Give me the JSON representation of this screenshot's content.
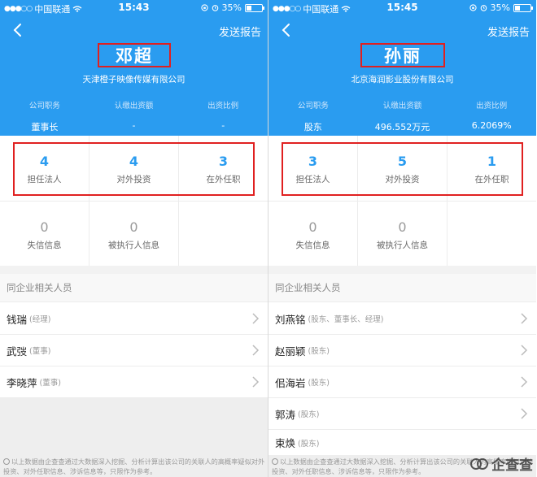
{
  "status_bar": {
    "left": {
      "carrier": "中国联通",
      "time": "15:43",
      "battery": "35%",
      "battery_level": 0.35
    },
    "right": {
      "carrier": "中国联通",
      "time": "15:45",
      "battery": "35%",
      "battery_level": 0.35
    }
  },
  "colors": {
    "header_blue": "#2a9cf0",
    "highlight_red": "#e02020",
    "stat_blue": "#2a9cf0"
  },
  "icons": {
    "back": "chevron-left-icon",
    "row": "chevron-right-icon",
    "wifi": "wifi-icon",
    "alarm": "alarm-icon",
    "lock": "lock-rotation-icon",
    "battery": "battery-icon"
  },
  "left": {
    "report_label": "发送报告",
    "name": "邓超",
    "company": "天津橙子映像传媒有限公司",
    "meta": [
      {
        "label": "公司职务",
        "value": "董事长"
      },
      {
        "label": "认缴出资额",
        "value": "-"
      },
      {
        "label": "出资比例",
        "value": "-"
      }
    ],
    "stats": [
      {
        "value": "4",
        "label": "担任法人"
      },
      {
        "value": "4",
        "label": "对外投资"
      },
      {
        "value": "3",
        "label": "在外任职"
      }
    ],
    "stats2": [
      {
        "value": "0",
        "label": "失信信息"
      },
      {
        "value": "0",
        "label": "被执行人信息"
      }
    ],
    "section_title": "同企业相关人员",
    "people": [
      {
        "name": "钱瑞",
        "role": "(经理)"
      },
      {
        "name": "武弢",
        "role": "(董事)"
      },
      {
        "name": "李晓萍",
        "role": "(董事)"
      }
    ],
    "footer": "以上数据由企查查通过大数据深入挖掘、分析计算出该公司的关联人的高概率疑似对外投资、对外任职信息、涉诉信息等，只限作为参考。"
  },
  "right": {
    "report_label": "发送报告",
    "name": "孙丽",
    "company": "北京海润影业股份有限公司",
    "meta": [
      {
        "label": "公司职务",
        "value": "股东"
      },
      {
        "label": "认缴出资额",
        "value": "496.552万元"
      },
      {
        "label": "出资比例",
        "value": "6.2069%"
      }
    ],
    "stats": [
      {
        "value": "3",
        "label": "担任法人"
      },
      {
        "value": "5",
        "label": "对外投资"
      },
      {
        "value": "1",
        "label": "在外任职"
      }
    ],
    "stats2": [
      {
        "value": "0",
        "label": "失信信息"
      },
      {
        "value": "0",
        "label": "被执行人信息"
      }
    ],
    "section_title": "同企业相关人员",
    "people": [
      {
        "name": "刘燕铭",
        "role": "(股东、董事长、经理)"
      },
      {
        "name": "赵丽颖",
        "role": "(股东)"
      },
      {
        "name": "佀海岩",
        "role": "(股东)"
      },
      {
        "name": "郭涛",
        "role": "(股东)"
      },
      {
        "name": "束焕",
        "role": "(股东)"
      }
    ],
    "footer": "以上数据由企查查通过大数据深入挖掘、分析计算出该公司的关联人的高概率疑似对外投资、对外任职信息、涉诉信息等，只限作为参考。"
  },
  "watermark": {
    "text": "企查查"
  }
}
